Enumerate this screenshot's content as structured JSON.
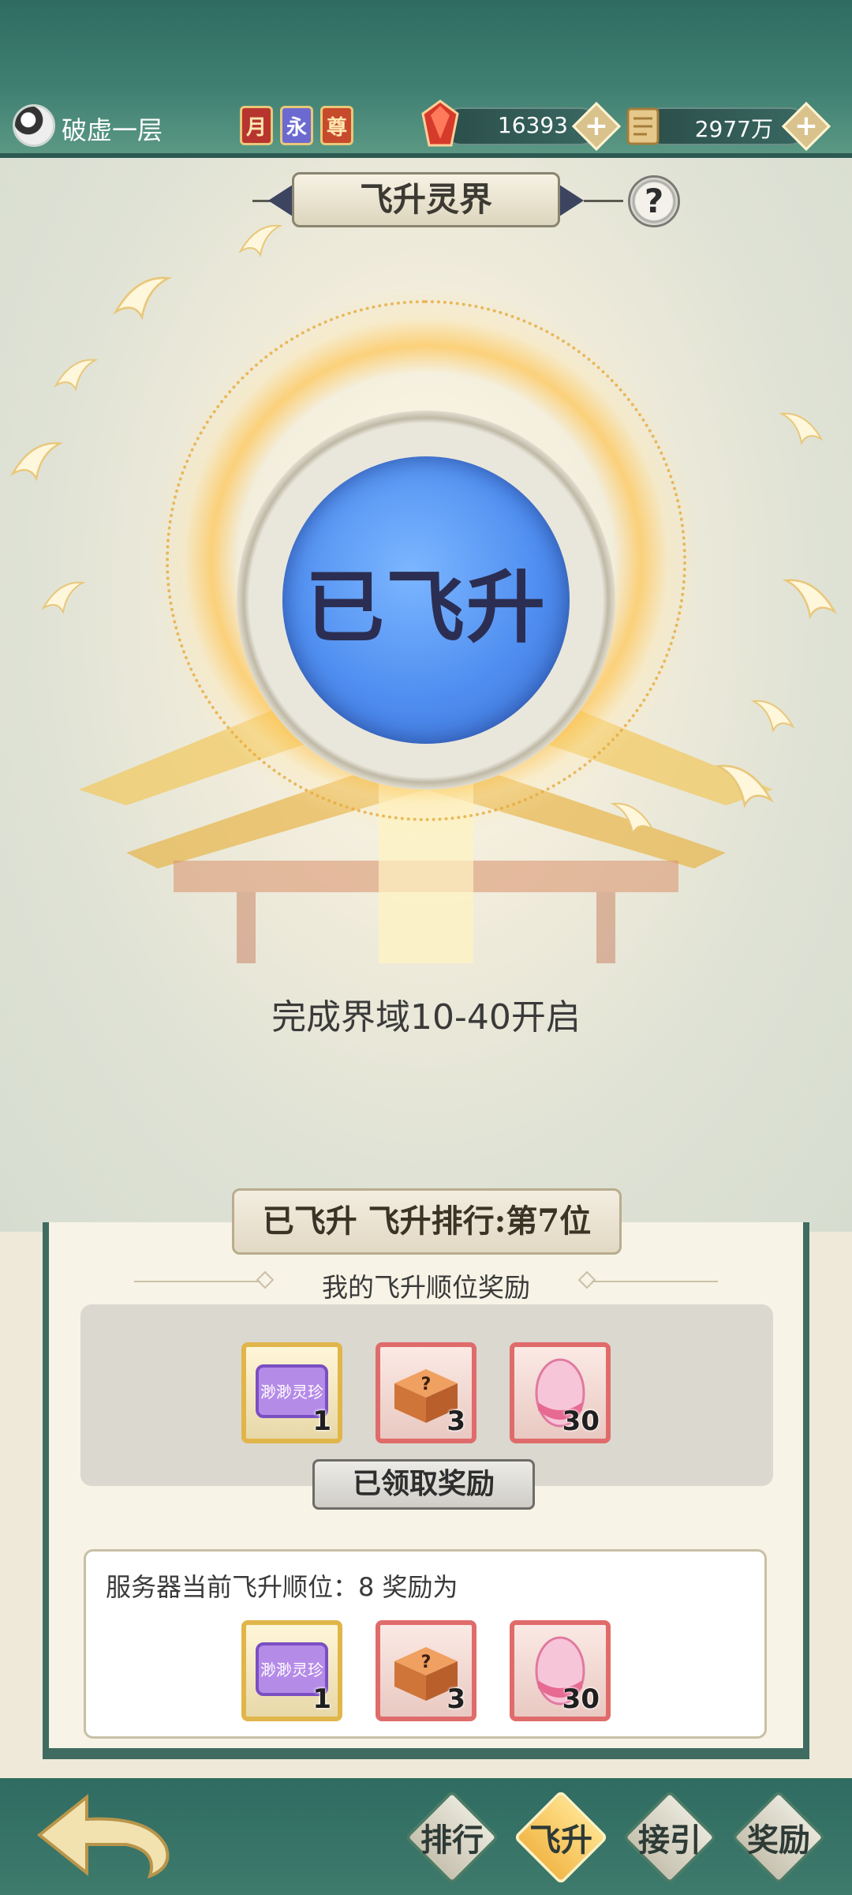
{
  "header": {
    "realm_name": "破虚一层",
    "badges": [
      {
        "label": "月",
        "color": "#b8342f"
      },
      {
        "label": "永",
        "color": "#6c6ad0"
      },
      {
        "label": "尊",
        "color": "#c64a2b"
      }
    ],
    "currencies": [
      {
        "icon": "red-gem-icon",
        "value": "16393"
      },
      {
        "icon": "scroll-icon",
        "value": "2977万"
      }
    ],
    "plus_label": "+"
  },
  "page_title": "飞升灵界",
  "help_label": "?",
  "orb_status": "已飞升",
  "unlock_condition": "完成界域10-40开启",
  "ranking": {
    "banner_status": "已飞升",
    "banner_rank": "飞升排行:第7位",
    "my_reward_heading": "我的飞升顺位奖励",
    "my_rewards": [
      {
        "icon": "scroll-token-icon",
        "name": "渺渺灵珍",
        "qty": "1",
        "frame": "gold"
      },
      {
        "icon": "mystery-chest-icon",
        "qty": "3",
        "frame": "red"
      },
      {
        "icon": "pink-crystal-icon",
        "qty": "30",
        "frame": "red"
      }
    ],
    "claimed_label": "已领取奖励",
    "server_line": "服务器当前飞升顺位：8   奖励为",
    "server_rewards": [
      {
        "icon": "scroll-token-icon",
        "name": "渺渺灵珍",
        "qty": "1",
        "frame": "gold"
      },
      {
        "icon": "mystery-chest-icon",
        "qty": "3",
        "frame": "red"
      },
      {
        "icon": "pink-crystal-icon",
        "qty": "30",
        "frame": "red"
      }
    ]
  },
  "nav": [
    {
      "label": "排行",
      "active": false
    },
    {
      "label": "飞升",
      "active": true
    },
    {
      "label": "接引",
      "active": false
    },
    {
      "label": "奖励",
      "active": false
    }
  ],
  "colors": {
    "theme_green": "#2f6b61",
    "orb_blue": "#4f8ef0",
    "gold_frame": "#e0b64a",
    "red_frame": "#e06b6b"
  }
}
